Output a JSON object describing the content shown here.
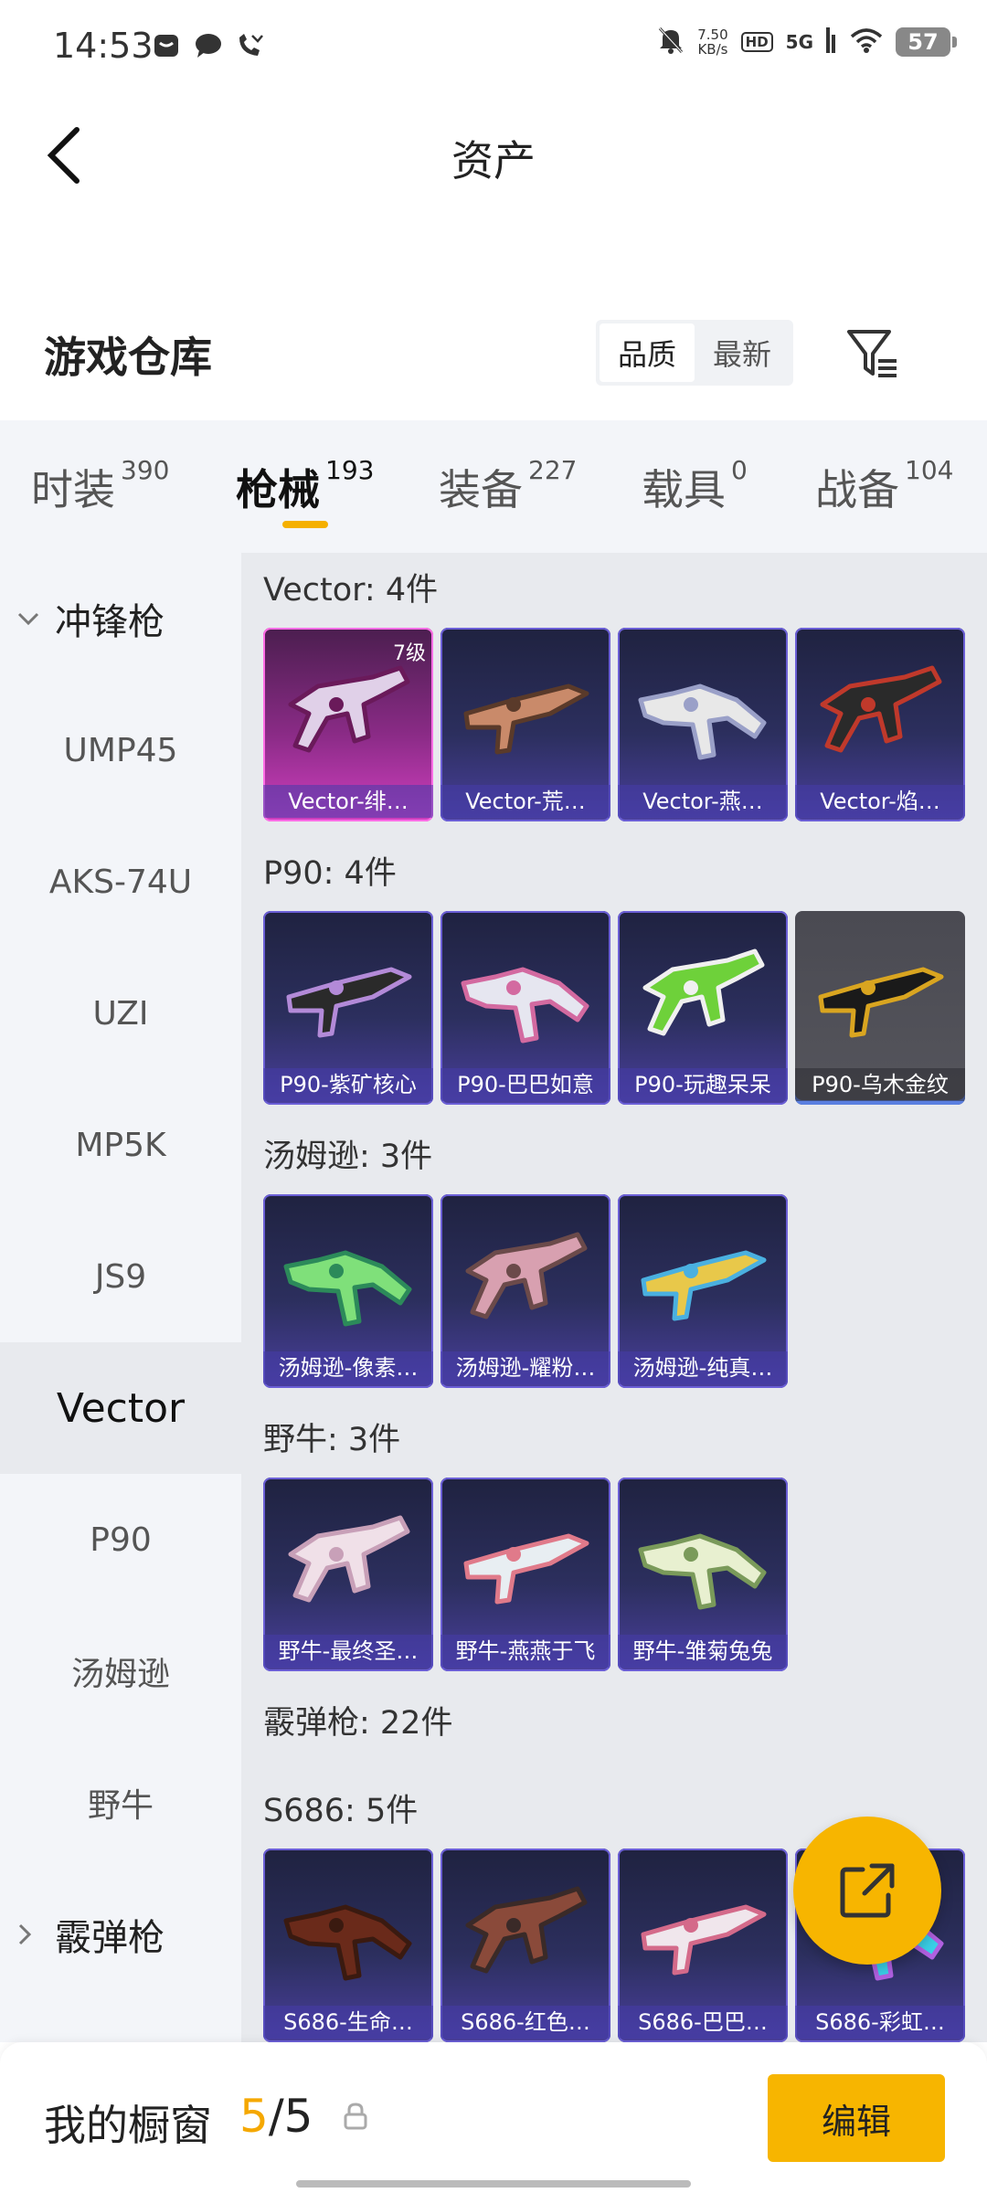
{
  "status_bar": {
    "time": "14:53",
    "net_speed": "7.50",
    "net_unit": "KB/s",
    "hd": "HD",
    "network": "5G",
    "battery": "57"
  },
  "header": {
    "title": "资产"
  },
  "warehouse": {
    "title": "游戏仓库",
    "sort_options": [
      "品质",
      "最新"
    ],
    "active_sort": "品质"
  },
  "tabs": [
    {
      "label": "时装",
      "count": "390"
    },
    {
      "label": "枪械",
      "count": "193",
      "active": true
    },
    {
      "label": "装备",
      "count": "227"
    },
    {
      "label": "载具",
      "count": "0"
    },
    {
      "label": "战备",
      "count": "104"
    }
  ],
  "sidebar": {
    "items": [
      {
        "label": "冲锋枪",
        "type": "group-expanded"
      },
      {
        "label": "UMP45"
      },
      {
        "label": "AKS-74U"
      },
      {
        "label": "UZI"
      },
      {
        "label": "MP5K"
      },
      {
        "label": "JS9"
      },
      {
        "label": "Vector",
        "active": true
      },
      {
        "label": "P90"
      },
      {
        "label": "汤姆逊"
      },
      {
        "label": "野牛"
      },
      {
        "label": "霰弹枪",
        "type": "group-collapsed"
      }
    ]
  },
  "sections": [
    {
      "title": "Vector: 4件",
      "items": [
        {
          "name": "Vector-绯…",
          "level": "7级",
          "style": "pink",
          "colors": [
            "#e0d0e8",
            "#6a1a5a"
          ]
        },
        {
          "name": "Vector-荒…",
          "colors": [
            "#c98a6a",
            "#5a3a2a"
          ]
        },
        {
          "name": "Vector-燕…",
          "colors": [
            "#e8e8e8",
            "#9aa0c8"
          ]
        },
        {
          "name": "Vector-焰…",
          "colors": [
            "#2a2a2a",
            "#c0392b"
          ]
        }
      ]
    },
    {
      "title": "P90: 4件",
      "items": [
        {
          "name": "P90-紫矿核心",
          "colors": [
            "#2a2a2a",
            "#b38ad8"
          ]
        },
        {
          "name": "P90-巴巴如意",
          "colors": [
            "#e6e6f0",
            "#d36aa0"
          ]
        },
        {
          "name": "P90-玩趣呆呆",
          "colors": [
            "#6ed13a",
            "#f0f0f0"
          ]
        },
        {
          "name": "P90-乌木金纹",
          "style": "gray",
          "colors": [
            "#1a1a1a",
            "#d9a520"
          ]
        }
      ]
    },
    {
      "title": "汤姆逊: 3件",
      "items": [
        {
          "name": "汤姆逊-像素…",
          "colors": [
            "#7fe07a",
            "#2c8a5a"
          ]
        },
        {
          "name": "汤姆逊-耀粉…",
          "colors": [
            "#d8a0b0",
            "#6b4a4a"
          ]
        },
        {
          "name": "汤姆逊-纯真…",
          "colors": [
            "#e8c84a",
            "#4ab0e0"
          ]
        }
      ]
    },
    {
      "title": "野牛: 3件",
      "items": [
        {
          "name": "野牛-最终圣…",
          "colors": [
            "#f0e0e8",
            "#c8a0b8"
          ]
        },
        {
          "name": "野牛-燕燕于飞",
          "colors": [
            "#e8eef2",
            "#e07a8a"
          ]
        },
        {
          "name": "野牛-雏菊兔兔",
          "colors": [
            "#e8f0d0",
            "#7a9a5a"
          ]
        }
      ]
    },
    {
      "title": "霰弹枪: 22件",
      "items": []
    },
    {
      "title": "S686: 5件",
      "items": [
        {
          "name": "S686-生命…",
          "colors": [
            "#6a2a1a",
            "#3a1a10"
          ]
        },
        {
          "name": "S686-红色…",
          "colors": [
            "#8a4a3a",
            "#3a2a28"
          ]
        },
        {
          "name": "S686-巴巴…",
          "colors": [
            "#f0e6ec",
            "#d46a8a"
          ]
        },
        {
          "name": "S686-彩虹…",
          "colors": [
            "#3ad0e8",
            "#b060e0"
          ]
        }
      ]
    }
  ],
  "showcase": {
    "label": "我的橱窗",
    "current": "5",
    "separator": "/",
    "total": "5",
    "edit_label": "编辑"
  },
  "colors": {
    "accent": "#f7b500",
    "tab_indicator": "#f5b000"
  }
}
